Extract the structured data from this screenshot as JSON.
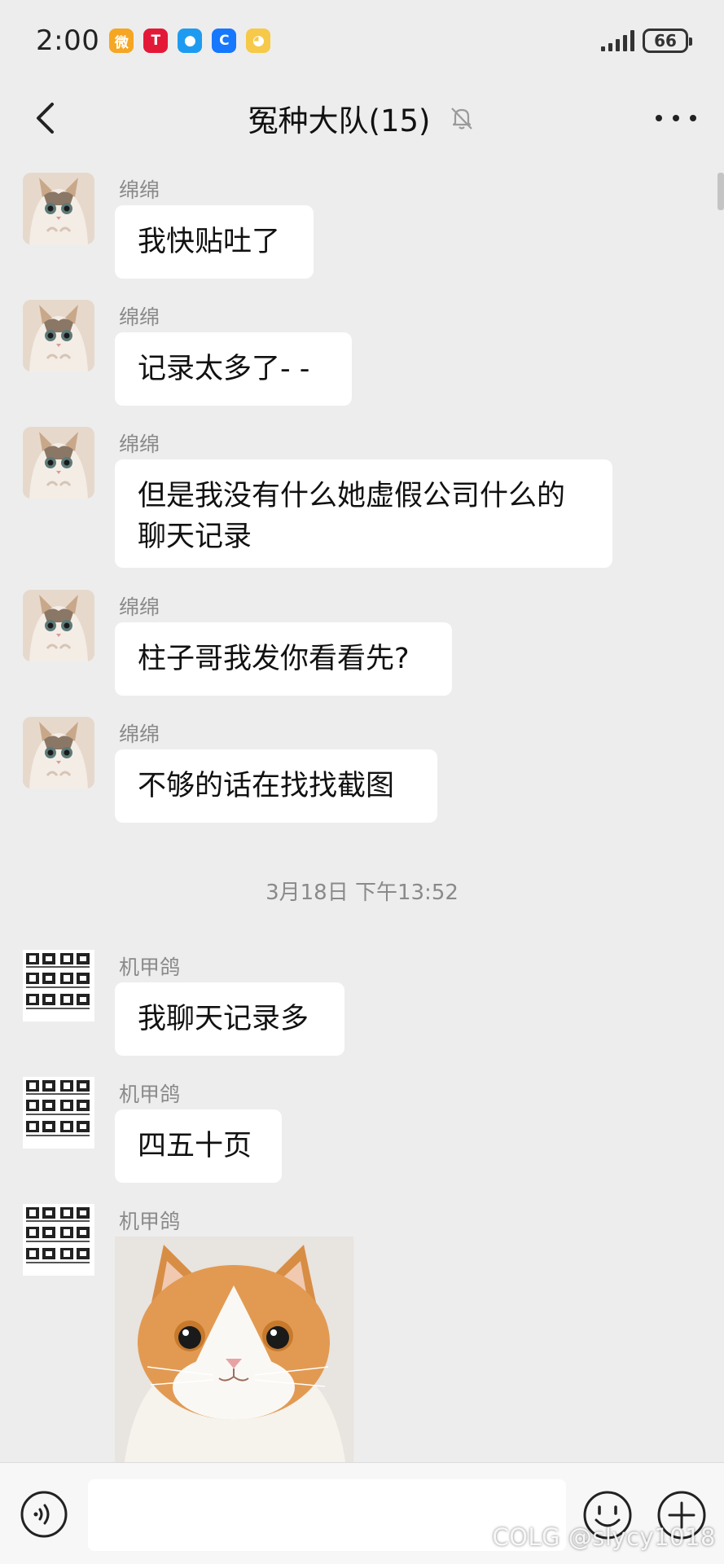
{
  "status_bar": {
    "time": "2:00",
    "battery": "66",
    "notification_icons": [
      "weibo-icon",
      "tesla-icon",
      "message-icon",
      "browser-icon",
      "game-icon"
    ]
  },
  "header": {
    "title": "冤种大队(15)"
  },
  "messages": [
    {
      "sender": "绵绵",
      "text": "我快贴吐了"
    },
    {
      "sender": "绵绵",
      "text": "记录太多了- -"
    },
    {
      "sender": "绵绵",
      "lines": [
        "但是我没有什么她虚假公司什么的",
        "聊天记录"
      ]
    },
    {
      "sender": "绵绵",
      "text": "柱子哥我发你看看先?"
    },
    {
      "sender": "绵绵",
      "text": "不够的话在找找截图"
    },
    {
      "sender": "机甲鸽",
      "text": "我聊天记录多"
    },
    {
      "sender": "机甲鸽",
      "text": "四五十页"
    },
    {
      "sender": "机甲鸽",
      "image": "orange-white-cat-photo"
    }
  ],
  "timestamp": "3月18日 下午13:52",
  "input_bar": {
    "placeholder": "",
    "watermark": "COLG @slycy1018"
  },
  "colors": {
    "background": "#ededed",
    "bubble": "#ffffff",
    "sender_name": "#8a8a8a"
  }
}
